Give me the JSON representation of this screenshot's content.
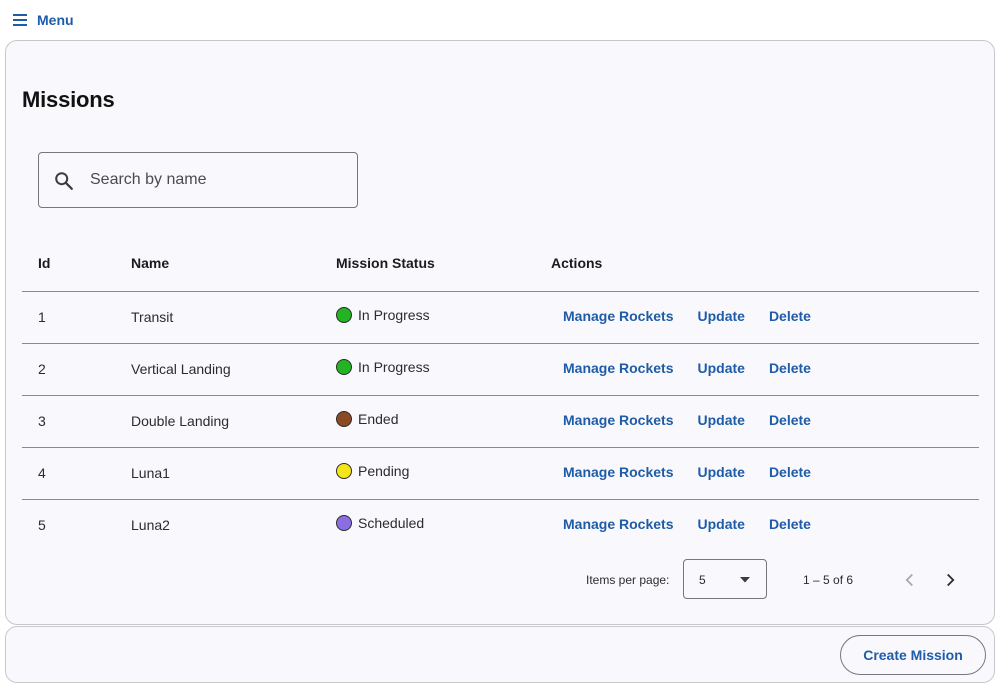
{
  "header": {
    "menu_label": "Menu"
  },
  "page": {
    "title": "Missions"
  },
  "search": {
    "placeholder": "Search by name",
    "value": ""
  },
  "table": {
    "columns": [
      "Id",
      "Name",
      "Mission Status",
      "Actions"
    ],
    "rows": [
      {
        "id": "1",
        "name": "Transit",
        "status": "In Progress",
        "status_color": "#22b422"
      },
      {
        "id": "2",
        "name": "Vertical Landing",
        "status": "In Progress",
        "status_color": "#22b422"
      },
      {
        "id": "3",
        "name": "Double Landing",
        "status": "Ended",
        "status_color": "#8b4a24"
      },
      {
        "id": "4",
        "name": "Luna1",
        "status": "Pending",
        "status_color": "#f5e61a"
      },
      {
        "id": "5",
        "name": "Luna2",
        "status": "Scheduled",
        "status_color": "#8b6ee0"
      }
    ],
    "actions": {
      "manage": "Manage Rockets",
      "update": "Update",
      "delete": "Delete"
    }
  },
  "paginator": {
    "items_per_page_label": "Items per page:",
    "items_per_page_value": "5",
    "range_label": "1 – 5 of 6"
  },
  "footer": {
    "create_label": "Create Mission"
  },
  "colors": {
    "accent": "#1f5ca8",
    "card_bg": "#f9f9fd",
    "border": "#c7c7cc"
  }
}
